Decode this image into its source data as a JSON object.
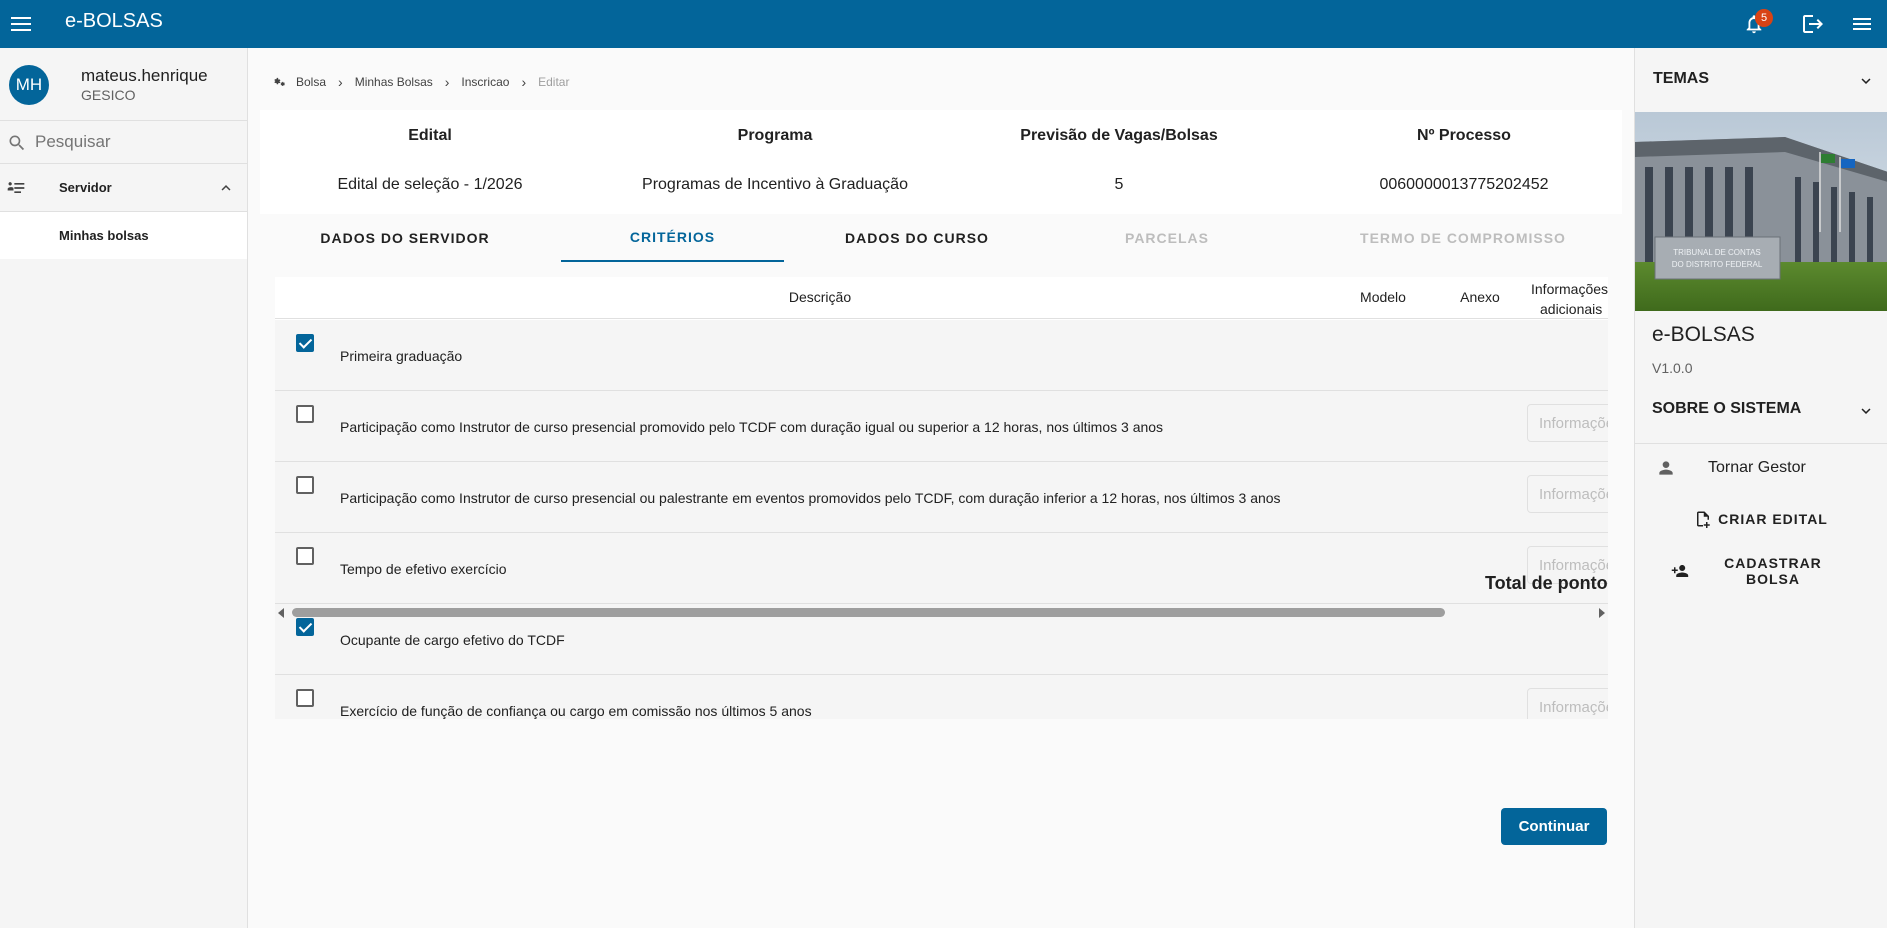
{
  "topbar": {
    "app_title": "e-BOLSAS",
    "notification_count": "5"
  },
  "sidebar": {
    "avatar_initials": "MH",
    "user_name": "mateus.henrique",
    "user_org": "GESICO",
    "search_placeholder": "Pesquisar",
    "group_label": "Servidor",
    "items": [
      {
        "label": "Minhas bolsas"
      }
    ]
  },
  "breadcrumb": {
    "items": [
      "Bolsa",
      "Minhas Bolsas",
      "Inscricao"
    ],
    "current": "Editar"
  },
  "info": {
    "headers": [
      "Edital",
      "Programa",
      "Previsão de Vagas/Bolsas",
      "Nº Processo"
    ],
    "values": [
      "Edital de seleção - 1/2026",
      "Programas de Incentivo à Graduação",
      "5",
      "0060000013775202452"
    ]
  },
  "tabs": [
    {
      "label": "DADOS DO SERVIDOR",
      "state": "normal"
    },
    {
      "label": "CRITÉRIOS",
      "state": "active"
    },
    {
      "label": "DADOS DO CURSO",
      "state": "normal"
    },
    {
      "label": "PARCELAS",
      "state": "disabled"
    },
    {
      "label": "TERMO DE COMPROMISSO",
      "state": "disabled"
    }
  ],
  "table": {
    "headers": {
      "descricao": "Descrição",
      "modelo": "Modelo",
      "anexo": "Anexo",
      "info_line1": "Informações",
      "info_line2": "adicionais"
    },
    "input_placeholder": "Informações adicionais",
    "rows": [
      {
        "checked": true,
        "description": "Primeira graduação",
        "has_input": false
      },
      {
        "checked": false,
        "description": "Participação como Instrutor de curso presencial promovido pelo TCDF com duração igual ou superior a 12 horas, nos últimos 3 anos",
        "has_input": true
      },
      {
        "checked": false,
        "description": "Participação como Instrutor de curso presencial ou palestrante em eventos promovidos pelo TCDF, com duração inferior a 12 horas, nos últimos 3 anos",
        "has_input": true
      },
      {
        "checked": false,
        "description": "Tempo de efetivo exercício",
        "has_input": true
      },
      {
        "checked": true,
        "description": "Ocupante de cargo efetivo do TCDF",
        "has_input": false
      },
      {
        "checked": false,
        "description": "Exercício de função de confiança ou cargo em comissão nos últimos 5 anos",
        "has_input": true
      }
    ],
    "total_label": "Total de pontos"
  },
  "actions": {
    "continue_label": "Continuar"
  },
  "right_panel": {
    "themes_label": "TEMAS",
    "image_sign_line1": "TRIBUNAL DE CONTAS",
    "image_sign_line2": "DO DISTRITO FEDERAL",
    "app_name": "e-BOLSAS",
    "version": "V1.0.0",
    "about_label": "SOBRE O SISTEMA",
    "gestor_label": "Tornar Gestor",
    "criar_edital_label": "CRIAR EDITAL",
    "cadastrar_bolsa_label": "CADASTRAR BOLSA"
  },
  "colors": {
    "primary": "#03659a",
    "badge": "#d84315"
  },
  "icons": [
    "menu-icon",
    "bell-icon",
    "logout-icon",
    "menu-right-icon",
    "search-icon",
    "person-list-icon",
    "chevron-up-icon",
    "chevron-right-icon",
    "chevron-down-icon",
    "person-icon",
    "file-plus-icon",
    "person-add-icon",
    "checkbox-icon"
  ]
}
